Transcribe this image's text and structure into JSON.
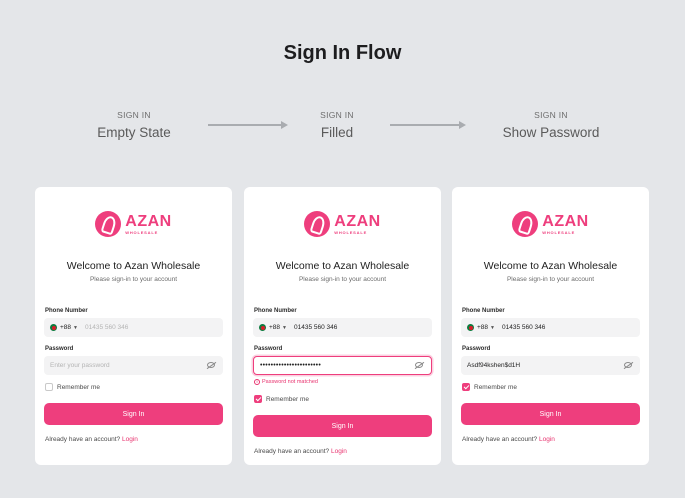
{
  "page_title": "Sign In Flow",
  "steps": [
    {
      "label": "SIGN IN",
      "state": "Empty State"
    },
    {
      "label": "SIGN IN",
      "state": "Filled"
    },
    {
      "label": "SIGN IN",
      "state": "Show Password"
    }
  ],
  "brand": {
    "name": "AZAN",
    "sub": "WHOLESALE",
    "accent": "#ee3e7d"
  },
  "form": {
    "welcome": "Welcome to Azan Wholesale",
    "subtitle": "Please sign-in to your account",
    "phone_label": "Phone Number",
    "country_code": "+88",
    "password_label": "Password",
    "remember": "Remember me",
    "signin_button": "Sign In",
    "footer_text": "Already have an account?",
    "footer_link": "Login"
  },
  "cards": [
    {
      "phone_placeholder": "01435 560 346",
      "password_placeholder": "Enter your password"
    },
    {
      "phone_value": "01435 560 346",
      "password_masked": "•••••••••••••••••••••••",
      "error": "Password not matched"
    },
    {
      "phone_value": "01435 560 346",
      "password_value": "Asdf94kshen$d1H"
    }
  ]
}
